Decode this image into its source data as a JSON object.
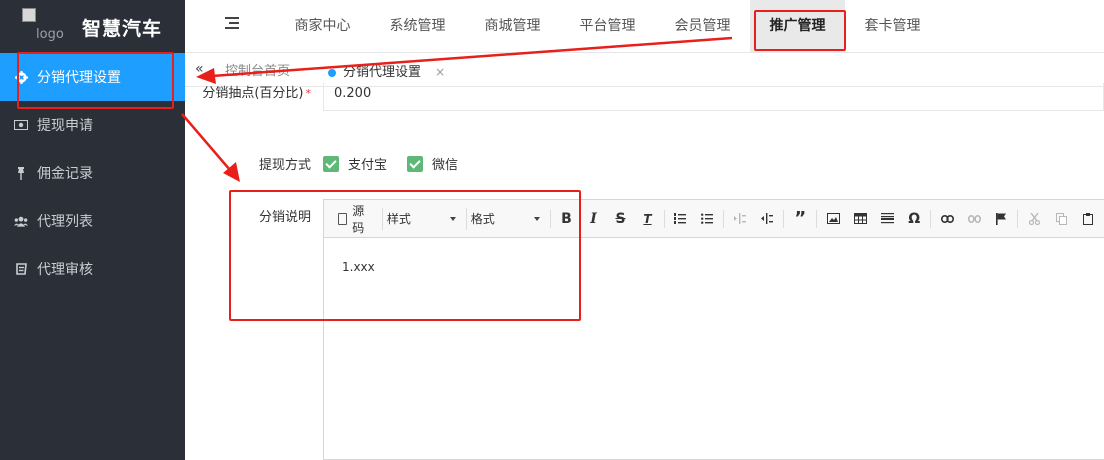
{
  "brand": {
    "logo_alt": "logo",
    "title": "智慧汽车"
  },
  "sidebar": {
    "items": [
      {
        "label": "分销代理设置",
        "icon": "settings-icon",
        "active": true
      },
      {
        "label": "提现申请",
        "icon": "money-icon"
      },
      {
        "label": "佣金记录",
        "icon": "pin-icon"
      },
      {
        "label": "代理列表",
        "icon": "users-icon"
      },
      {
        "label": "代理审核",
        "icon": "audit-icon"
      }
    ]
  },
  "topnav": {
    "items": [
      {
        "label": "商家中心"
      },
      {
        "label": "系统管理"
      },
      {
        "label": "商城管理"
      },
      {
        "label": "平台管理"
      },
      {
        "label": "会员管理"
      },
      {
        "label": "推广管理",
        "active": true
      },
      {
        "label": "套卡管理"
      }
    ]
  },
  "tabs": {
    "collapse_glyph": "«",
    "first_label": "控制台首页",
    "current_label": "分销代理设置",
    "close_glyph": "×"
  },
  "form": {
    "commission_label": "分销抽点(百分比)",
    "commission_value": "0.200",
    "withdraw_label": "提现方式",
    "withdraw_options": [
      {
        "label": "支付宝",
        "checked": true
      },
      {
        "label": "微信",
        "checked": true
      }
    ],
    "desc_label": "分销说明",
    "editor": {
      "source_label": "源码",
      "style_label": "样式",
      "format_label": "格式",
      "content": "1.xxx"
    }
  },
  "colors": {
    "sidebar_bg": "#2b3038",
    "active_blue": "#1e9fff",
    "annotation_red": "#e8201b",
    "checkbox_green": "#5fb878"
  }
}
